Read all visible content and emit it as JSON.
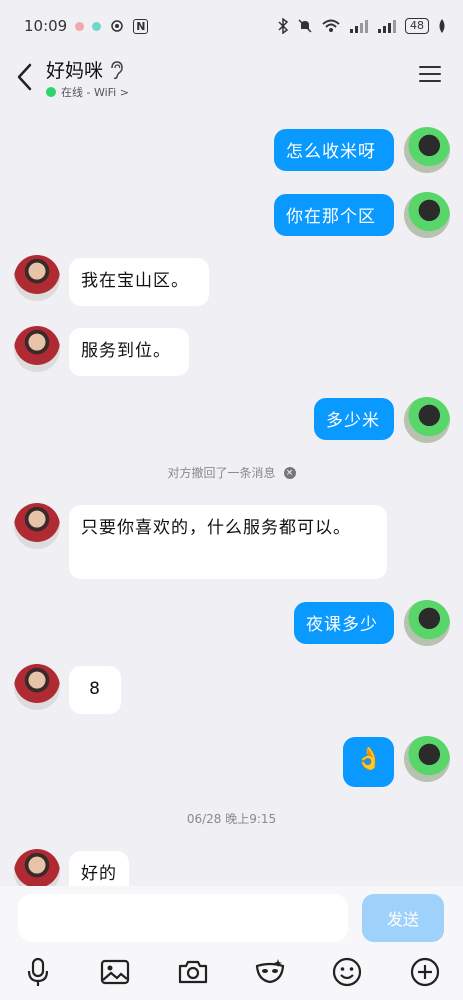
{
  "status_bar": {
    "time": "10:09",
    "nfc_label": "N",
    "battery": "48"
  },
  "header": {
    "title": "好妈咪",
    "status_text": "在线 - WiFi >"
  },
  "messages": [
    {
      "side": "out",
      "text": "怎么收米呀"
    },
    {
      "side": "out",
      "text": "你在那个区"
    },
    {
      "side": "in",
      "text": "我在宝山区。"
    },
    {
      "side": "in",
      "text": "服务到位。"
    },
    {
      "side": "out",
      "text": "多少米"
    },
    {
      "side": "system",
      "text": "对方撤回了一条消息"
    },
    {
      "side": "in",
      "text": "只要你喜欢的，什么服务都可以。"
    },
    {
      "side": "out",
      "text": "夜课多少"
    },
    {
      "side": "in",
      "text": "8"
    },
    {
      "side": "out",
      "text": "👌"
    },
    {
      "side": "system",
      "text": "06/28 晚上9:15"
    },
    {
      "side": "in",
      "text": "好的"
    }
  ],
  "input": {
    "placeholder": "",
    "send_label": "发送"
  },
  "colors": {
    "outgoing_bubble": "#0a99ff",
    "incoming_bubble": "#ffffff",
    "background": "#f0eff4",
    "online": "#2fd36a"
  }
}
